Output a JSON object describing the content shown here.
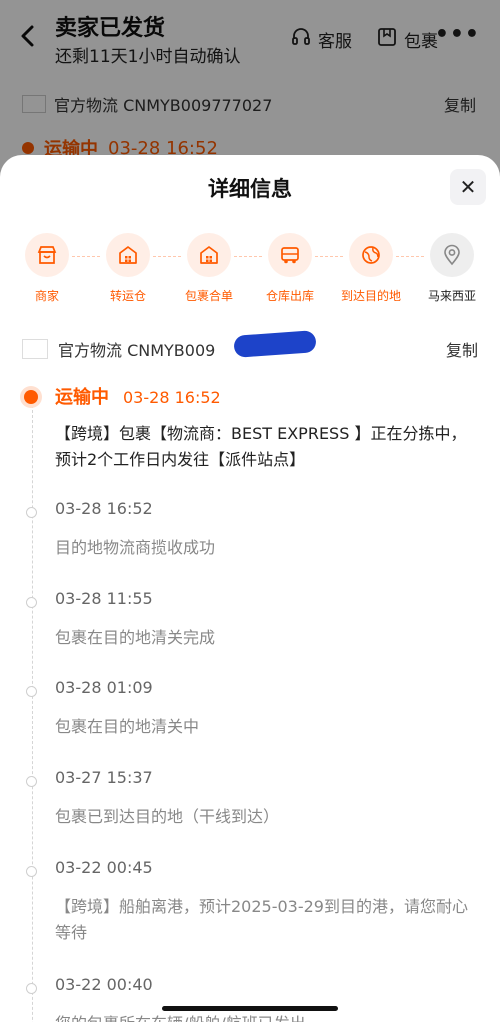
{
  "background": {
    "title": "卖家已发货",
    "subtitle": "还剩11天1小时自动确认",
    "actions": [
      {
        "label": "客服",
        "icon": "headset-icon"
      },
      {
        "label": "包裹",
        "icon": "package-icon"
      }
    ],
    "more": "•••",
    "carrier_text": "官方物流 CNMYB009777027",
    "copy": "复制",
    "status": "运输中",
    "status_time": "03-28 16:52"
  },
  "sheet": {
    "title": "详细信息",
    "close": "✕",
    "steps": [
      {
        "label": "商家",
        "icon": "store-icon"
      },
      {
        "label": "转运仓",
        "icon": "warehouse-icon"
      },
      {
        "label": "包裹合单",
        "icon": "warehouse-icon"
      },
      {
        "label": "仓库出库",
        "icon": "truck-icon"
      },
      {
        "label": "到达目的地",
        "icon": "globe-icon"
      },
      {
        "label": "马来西亚",
        "icon": "location-pin-icon"
      }
    ],
    "carrier_text": "官方物流 CNMYB009",
    "copy": "复制",
    "events": [
      {
        "status": "运输中",
        "time": "03-28 16:52",
        "desc": "【跨境】包裹【物流商：BEST EXPRESS 】正在分拣中，预计2个工作日内发往【派件站点】"
      },
      {
        "time": "03-28 16:52",
        "desc": "目的地物流商揽收成功"
      },
      {
        "time": "03-28 11:55",
        "desc": "包裹在目的地清关完成"
      },
      {
        "time": "03-28 01:09",
        "desc": "包裹在目的地清关中"
      },
      {
        "time": "03-27 15:37",
        "desc": "包裹已到达目的地（干线到达）"
      },
      {
        "time": "03-22 00:45",
        "desc": "【跨境】船舶离港，预计2025-03-29到目的港，请您耐心等待"
      },
      {
        "time": "03-22 00:40",
        "desc": "您的包裹所在车辆/船舶/航班已发出"
      }
    ]
  },
  "colors": {
    "accent": "#ff5a00",
    "accent_soft": "#ffeee6",
    "redaction": "#1d43c9"
  }
}
